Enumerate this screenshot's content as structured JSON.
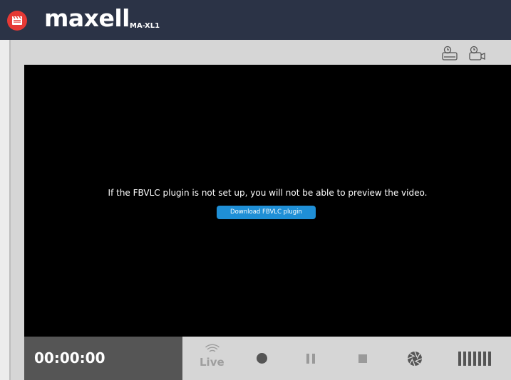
{
  "header": {
    "brand": "maxell",
    "model": "MA-XL1",
    "app_icon": "clapperboard-icon"
  },
  "toolbar": {
    "icons": [
      "storage-icon",
      "camera-settings-icon"
    ]
  },
  "video": {
    "message": "If the FBVLC plugin is not set up, you will not be able to preview the video.",
    "download_label": "Download FBVLC plugin"
  },
  "controls": {
    "timer": "00:00:00",
    "live_label": "Live",
    "icons": [
      "live-icon",
      "record-icon",
      "pause-icon",
      "stop-icon",
      "snapshot-icon",
      "signal-bars-icon"
    ]
  },
  "colors": {
    "header_bg": "#2b3346",
    "app_icon_bg": "#e53935",
    "button_blue": "#1f8fd6",
    "timer_bg": "#555555",
    "panel_gray": "#d6d6d6"
  }
}
